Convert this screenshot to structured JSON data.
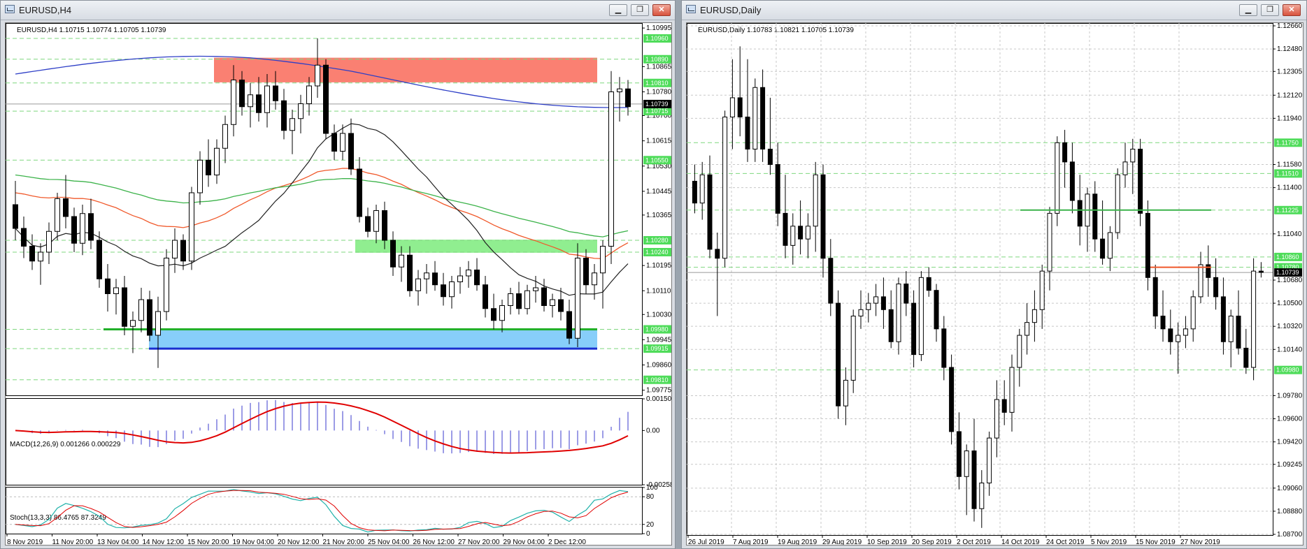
{
  "left_window": {
    "title": "EURUSD,H4",
    "buttons": {
      "minimize": "▁",
      "restore": "❐",
      "close": "✕"
    },
    "header_text": "EURUSD,H4  1.10715 1.10774 1.10705 1.10739",
    "price_labels": [
      "1.10995",
      "1.10865",
      "1.10780",
      "1.10700",
      "1.10615",
      "1.10530",
      "1.10445",
      "1.10365",
      "1.10195",
      "1.10110",
      "1.10030",
      "1.09945",
      "1.09860",
      "1.09775"
    ],
    "green_labels": [
      "1.10960",
      "1.10890",
      "1.10810",
      "1.10715",
      "1.10550",
      "1.10280",
      "1.10240",
      "1.09980",
      "1.09915",
      "1.09810"
    ],
    "current_price": "1.10739",
    "time_labels": [
      "8 Nov 2019",
      "11 Nov 20:00",
      "13 Nov 04:00",
      "14 Nov 12:00",
      "15 Nov 20:00",
      "19 Nov 04:00",
      "20 Nov 12:00",
      "21 Nov 20:00",
      "25 Nov 04:00",
      "26 Nov 12:00",
      "27 Nov 20:00",
      "29 Nov 04:00",
      "2 Dec 12:00"
    ],
    "macd": {
      "header": "MACD(12,26,9) 0.001266 0.000229",
      "labels": [
        "0.001509",
        "0.00",
        "-0.002583"
      ]
    },
    "stoch": {
      "header": "Stoch(13,3,3) 86.4765 87.3249",
      "labels": [
        "100",
        "80",
        "20",
        "0"
      ]
    },
    "colors": {
      "resistance_zone": "#fa8072",
      "support_zone_green": "#90ee90",
      "support_zone_blue": "#87cefa",
      "ma_blue": "#2e3fc7",
      "ma_red": "#f0592b",
      "ma_green": "#3cb34a",
      "ma_black": "#222222",
      "macd_hist": "#3a3acc",
      "macd_signal": "#e00000",
      "stoch_main": "#20b2aa",
      "stoch_signal": "#e00000"
    }
  },
  "right_window": {
    "title": "EURUSD,Daily",
    "buttons": {
      "minimize": "▁",
      "restore": "❐",
      "close": "✕"
    },
    "header_text": "EURUSD,Daily  1.10783 1.10821 1.10705 1.10739",
    "price_labels": [
      "1.12660",
      "1.12480",
      "1.12305",
      "1.12120",
      "1.11940",
      "1.11580",
      "1.11400",
      "1.11040",
      "1.10680",
      "1.10500",
      "1.10320",
      "1.10140",
      "1.09780",
      "1.09600",
      "1.09420",
      "1.09245",
      "1.09060",
      "1.08880",
      "1.08700"
    ],
    "green_labels": [
      "1.11750",
      "1.11510",
      "1.11225",
      "1.10860",
      "1.10780",
      "1.09980"
    ],
    "current_price": "1.10739",
    "time_labels": [
      "26 Jul 2019",
      "7 Aug 2019",
      "19 Aug 2019",
      "29 Aug 2019",
      "10 Sep 2019",
      "20 Sep 2019",
      "2 Oct 2019",
      "14 Oct 2019",
      "24 Oct 2019",
      "5 Nov 2019",
      "15 Nov 2019",
      "27 Nov 2019"
    ],
    "colors": {
      "green_level": "#3cb34a",
      "red_level": "#f0592b"
    }
  },
  "candles_h4": [
    [
      1.104,
      1.1048,
      1.1028,
      1.1032
    ],
    [
      1.1032,
      1.1036,
      1.1022,
      1.1026
    ],
    [
      1.1026,
      1.103,
      1.1018,
      1.1021
    ],
    [
      1.1021,
      1.1027,
      1.1013,
      1.1024
    ],
    [
      1.1024,
      1.1034,
      1.102,
      1.1031
    ],
    [
      1.1031,
      1.1044,
      1.1028,
      1.1042
    ],
    [
      1.1042,
      1.105,
      1.1032,
      1.1036
    ],
    [
      1.1036,
      1.1039,
      1.1024,
      1.1027
    ],
    [
      1.1027,
      1.104,
      1.1023,
      1.1037
    ],
    [
      1.1037,
      1.1042,
      1.1025,
      1.1028
    ],
    [
      1.1028,
      1.1031,
      1.1012,
      1.1015
    ],
    [
      1.1015,
      1.102,
      1.1004,
      1.101
    ],
    [
      1.101,
      1.1015,
      1.1003,
      1.1012
    ],
    [
      1.1012,
      1.1016,
      1.0996,
      1.0999
    ],
    [
      1.0999,
      1.1004,
      1.099,
      1.1001
    ],
    [
      1.1001,
      1.1012,
      1.0997,
      1.1008
    ],
    [
      1.1008,
      1.1011,
      1.0994,
      1.0996
    ],
    [
      1.0996,
      1.1009,
      1.0985,
      1.1004
    ],
    [
      1.1004,
      1.1025,
      1.1001,
      1.1022
    ],
    [
      1.1022,
      1.1032,
      1.1017,
      1.1028
    ],
    [
      1.1028,
      1.103,
      1.1018,
      1.1021
    ],
    [
      1.1021,
      1.1046,
      1.1018,
      1.1044
    ],
    [
      1.1044,
      1.1058,
      1.104,
      1.1055
    ],
    [
      1.1055,
      1.1062,
      1.1046,
      1.105
    ],
    [
      1.105,
      1.1062,
      1.1047,
      1.1059
    ],
    [
      1.1059,
      1.107,
      1.1054,
      1.1067
    ],
    [
      1.1067,
      1.1087,
      1.1063,
      1.1082
    ],
    [
      1.1082,
      1.1085,
      1.107,
      1.1073
    ],
    [
      1.1073,
      1.1081,
      1.1066,
      1.1077
    ],
    [
      1.1077,
      1.1083,
      1.1068,
      1.1071
    ],
    [
      1.1071,
      1.1084,
      1.1066,
      1.108
    ],
    [
      1.108,
      1.1085,
      1.1072,
      1.1075
    ],
    [
      1.1075,
      1.1079,
      1.1062,
      1.1065
    ],
    [
      1.1065,
      1.1072,
      1.1057,
      1.1069
    ],
    [
      1.1069,
      1.1077,
      1.1064,
      1.1074
    ],
    [
      1.1074,
      1.1083,
      1.107,
      1.108
    ],
    [
      1.108,
      1.1096,
      1.1076,
      1.1087
    ],
    [
      1.1087,
      1.1089,
      1.1062,
      1.1064
    ],
    [
      1.1064,
      1.1067,
      1.1055,
      1.1058
    ],
    [
      1.1058,
      1.1067,
      1.1055,
      1.1064
    ],
    [
      1.1064,
      1.1069,
      1.105,
      1.1052
    ],
    [
      1.1052,
      1.1056,
      1.1034,
      1.1036
    ],
    [
      1.1036,
      1.1039,
      1.1029,
      1.1031
    ],
    [
      1.1031,
      1.104,
      1.1027,
      1.1038
    ],
    [
      1.1038,
      1.1041,
      1.1025,
      1.1028
    ],
    [
      1.1028,
      1.1031,
      1.1016,
      1.1019
    ],
    [
      1.1019,
      1.1026,
      1.1014,
      1.1023
    ],
    [
      1.1023,
      1.1026,
      1.1009,
      1.1011
    ],
    [
      1.1011,
      1.1018,
      1.1006,
      1.1015
    ],
    [
      1.1015,
      1.102,
      1.101,
      1.1017
    ],
    [
      1.1017,
      1.1021,
      1.1011,
      1.1013
    ],
    [
      1.1013,
      1.1017,
      1.1006,
      1.1009
    ],
    [
      1.1009,
      1.1016,
      1.1005,
      1.1014
    ],
    [
      1.1014,
      1.1019,
      1.101,
      1.1016
    ],
    [
      1.1016,
      1.1021,
      1.1012,
      1.1018
    ],
    [
      1.1018,
      1.1022,
      1.1011,
      1.1013
    ],
    [
      1.1013,
      1.1016,
      1.1002,
      1.1005
    ],
    [
      1.1005,
      1.101,
      1.0998,
      1.1001
    ],
    [
      1.1001,
      1.1008,
      1.0997,
      1.1006
    ],
    [
      1.1006,
      1.1012,
      1.1003,
      1.101
    ],
    [
      1.101,
      1.1014,
      1.1003,
      1.1005
    ],
    [
      1.1005,
      1.1013,
      1.1003,
      1.1011
    ],
    [
      1.1011,
      1.1016,
      1.1007,
      1.1012
    ],
    [
      1.1012,
      1.1015,
      1.1004,
      1.1006
    ],
    [
      1.1006,
      1.101,
      1.1002,
      1.1008
    ],
    [
      1.1008,
      1.1012,
      1.1001,
      1.1004
    ],
    [
      1.1004,
      1.1008,
      1.0993,
      1.0995
    ],
    [
      1.0995,
      1.1027,
      1.0992,
      1.1022
    ],
    [
      1.1022,
      1.1025,
      1.101,
      1.1013
    ],
    [
      1.1013,
      1.102,
      1.1008,
      1.1017
    ],
    [
      1.1017,
      1.1028,
      1.1005,
      1.1026
    ],
    [
      1.1026,
      1.1085,
      1.102,
      1.1078
    ],
    [
      1.1078,
      1.1083,
      1.1068,
      1.1079
    ],
    [
      1.1079,
      1.1082,
      1.107,
      1.1073
    ]
  ],
  "candles_d1": [
    [
      1.1145,
      1.1158,
      1.112,
      1.1128
    ],
    [
      1.1128,
      1.116,
      1.1115,
      1.115
    ],
    [
      1.115,
      1.1165,
      1.1085,
      1.1092
    ],
    [
      1.1092,
      1.1105,
      1.104,
      1.1085
    ],
    [
      1.1085,
      1.12,
      1.1078,
      1.1195
    ],
    [
      1.1195,
      1.124,
      1.117,
      1.121
    ],
    [
      1.121,
      1.125,
      1.118,
      1.1195
    ],
    [
      1.1195,
      1.124,
      1.116,
      1.117
    ],
    [
      1.117,
      1.1225,
      1.116,
      1.1218
    ],
    [
      1.1218,
      1.1232,
      1.116,
      1.117
    ],
    [
      1.117,
      1.121,
      1.115,
      1.1158
    ],
    [
      1.1158,
      1.1175,
      1.111,
      1.112
    ],
    [
      1.112,
      1.115,
      1.1085,
      1.1095
    ],
    [
      1.1095,
      1.112,
      1.108,
      1.111
    ],
    [
      1.111,
      1.113,
      1.1088,
      1.11
    ],
    [
      1.11,
      1.112,
      1.1085,
      1.111
    ],
    [
      1.111,
      1.116,
      1.109,
      1.115
    ],
    [
      1.115,
      1.1158,
      1.107,
      1.1085
    ],
    [
      1.1085,
      1.11,
      1.104,
      1.105
    ],
    [
      1.105,
      1.106,
      1.096,
      1.097
    ],
    [
      1.097,
      1.1,
      1.0955,
      1.099
    ],
    [
      1.099,
      1.1045,
      1.098,
      1.104
    ],
    [
      1.104,
      1.106,
      1.103,
      1.1045
    ],
    [
      1.1045,
      1.1058,
      1.1035,
      1.105
    ],
    [
      1.105,
      1.1065,
      1.104,
      1.1055
    ],
    [
      1.1055,
      1.107,
      1.103,
      1.1045
    ],
    [
      1.1045,
      1.106,
      1.1015,
      1.102
    ],
    [
      1.102,
      1.107,
      1.101,
      1.1065
    ],
    [
      1.1065,
      1.1075,
      1.104,
      1.105
    ],
    [
      1.105,
      1.106,
      1.1,
      1.101
    ],
    [
      1.101,
      1.1075,
      1.1005,
      1.107
    ],
    [
      1.107,
      1.1078,
      1.1055,
      1.106
    ],
    [
      1.106,
      1.1065,
      1.102,
      1.103
    ],
    [
      1.103,
      1.104,
      1.099,
      1.1
    ],
    [
      1.1,
      1.101,
      1.094,
      1.095
    ],
    [
      1.095,
      1.0965,
      1.0905,
      1.0915
    ],
    [
      1.0915,
      1.094,
      1.0885,
      1.0935
    ],
    [
      1.0935,
      1.096,
      1.088,
      1.089
    ],
    [
      1.089,
      1.092,
      1.0875,
      1.091
    ],
    [
      1.091,
      1.095,
      1.09,
      1.0945
    ],
    [
      1.0945,
      1.099,
      1.093,
      1.0975
    ],
    [
      1.0975,
      1.099,
      1.0955,
      1.0965
    ],
    [
      1.0965,
      1.101,
      1.095,
      1.1
    ],
    [
      1.1,
      1.103,
      1.0985,
      1.1025
    ],
    [
      1.1025,
      1.105,
      1.101,
      1.1035
    ],
    [
      1.1035,
      1.106,
      1.102,
      1.1045
    ],
    [
      1.1045,
      1.108,
      1.103,
      1.1075
    ],
    [
      1.1075,
      1.1125,
      1.106,
      1.112
    ],
    [
      1.112,
      1.118,
      1.111,
      1.1175
    ],
    [
      1.1175,
      1.1185,
      1.114,
      1.116
    ],
    [
      1.116,
      1.1175,
      1.112,
      1.113
    ],
    [
      1.113,
      1.115,
      1.1095,
      1.111
    ],
    [
      1.111,
      1.114,
      1.109,
      1.1135
    ],
    [
      1.1135,
      1.1145,
      1.109,
      1.11
    ],
    [
      1.11,
      1.113,
      1.108,
      1.1085
    ],
    [
      1.1085,
      1.111,
      1.1075,
      1.1105
    ],
    [
      1.1105,
      1.1155,
      1.11,
      1.115
    ],
    [
      1.115,
      1.1175,
      1.114,
      1.116
    ],
    [
      1.116,
      1.1178,
      1.1135,
      1.117
    ],
    [
      1.117,
      1.1178,
      1.111,
      1.112
    ],
    [
      1.112,
      1.113,
      1.106,
      1.107
    ],
    [
      1.107,
      1.108,
      1.103,
      1.104
    ],
    [
      1.104,
      1.106,
      1.102,
      1.103
    ],
    [
      1.103,
      1.1045,
      1.101,
      1.102
    ],
    [
      1.102,
      1.1035,
      1.0995,
      1.1025
    ],
    [
      1.1025,
      1.104,
      1.1015,
      1.103
    ],
    [
      1.103,
      1.106,
      1.102,
      1.1055
    ],
    [
      1.1055,
      1.109,
      1.105,
      1.108
    ],
    [
      1.108,
      1.1095,
      1.1055,
      1.107
    ],
    [
      1.107,
      1.1085,
      1.1045,
      1.1055
    ],
    [
      1.1055,
      1.107,
      1.101,
      1.102
    ],
    [
      1.102,
      1.1045,
      1.1,
      1.104
    ],
    [
      1.104,
      1.106,
      1.101,
      1.1015
    ],
    [
      1.1015,
      1.103,
      1.0995,
      1.1
    ],
    [
      1.1,
      1.1085,
      1.099,
      1.1075
    ],
    [
      1.1075,
      1.1082,
      1.107,
      1.1074
    ]
  ]
}
